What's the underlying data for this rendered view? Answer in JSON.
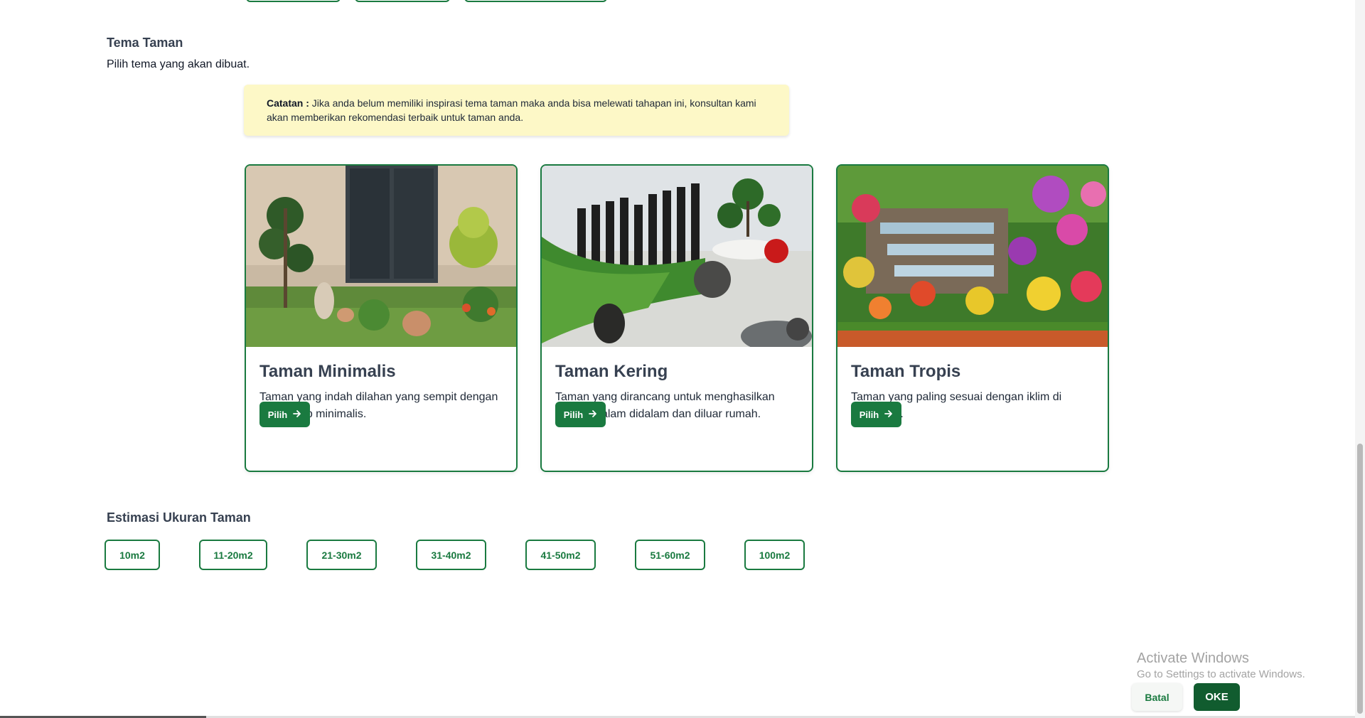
{
  "colors": {
    "accent": "#1a7a40",
    "accent_dark": "#115c2f",
    "note_bg": "#fdf8c7"
  },
  "theme_section": {
    "title": "Tema Taman",
    "subtitle": "Pilih tema yang akan dibuat.",
    "note_label": "Catatan :",
    "note_text": "Jika anda belum memiliki inspirasi tema taman maka anda bisa melewati tahapan ini, konsultan kami akan memberikan rekomendasi terbaik untuk taman anda."
  },
  "cards": [
    {
      "title": "Taman Minimalis",
      "desc": "Taman yang indah dilahan yang sempit dengan berkonsep minimalis.",
      "button": "Pilih",
      "button_icon": "arrow-right-icon"
    },
    {
      "title": "Taman Kering",
      "desc": "Taman yang dirancang untuk menghasilkan suasana alam didalam dan diluar rumah.",
      "button": "Pilih",
      "button_icon": "arrow-right-icon"
    },
    {
      "title": "Taman Tropis",
      "desc": "Taman yang paling sesuai dengan iklim di Indonesia.",
      "button": "Pilih",
      "button_icon": "arrow-right-icon"
    }
  ],
  "size_section": {
    "title": "Estimasi Ukuran Taman",
    "options": [
      "10m2",
      "11-20m2",
      "21-30m2",
      "31-40m2",
      "41-50m2",
      "51-60m2",
      "100m2"
    ]
  },
  "footer": {
    "cancel_label": "Batal",
    "ok_label": "OKE"
  },
  "windows_watermark": {
    "line1": "Activate Windows",
    "line2": "Go to Settings to activate Windows."
  }
}
